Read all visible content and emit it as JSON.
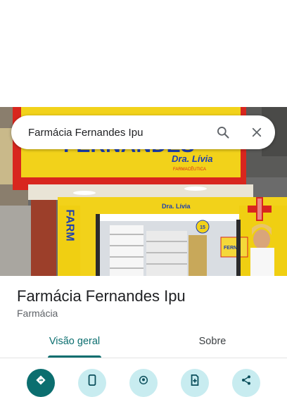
{
  "search": {
    "query": "Farmácia Fernandes Ipu"
  },
  "place": {
    "name": "Farmácia Fernandes Ipu",
    "category": "Farmácia"
  },
  "photo": {
    "sign_top": "FERNANDES",
    "sign_doctor": "Dra. Lívia",
    "sign_sub": "FARMACÊUTICA",
    "vertical_word": "FARM",
    "badge": "15",
    "poster_text": "FERNA"
  },
  "tabs": [
    {
      "label": "Visão geral",
      "active": true
    },
    {
      "label": "Sobre",
      "active": false
    }
  ],
  "actions": [
    {
      "icon": "directions-icon",
      "variant": "primary"
    },
    {
      "icon": "phone-icon",
      "variant": "secondary"
    },
    {
      "icon": "nearby-icon",
      "variant": "secondary"
    },
    {
      "icon": "save-icon",
      "variant": "secondary"
    },
    {
      "icon": "share-icon",
      "variant": "secondary"
    }
  ],
  "colors": {
    "accent": "#0b6e6f",
    "action_bg": "#c8ecf0",
    "storefront_yellow": "#f2d21a",
    "sign_red": "#d8261e"
  }
}
